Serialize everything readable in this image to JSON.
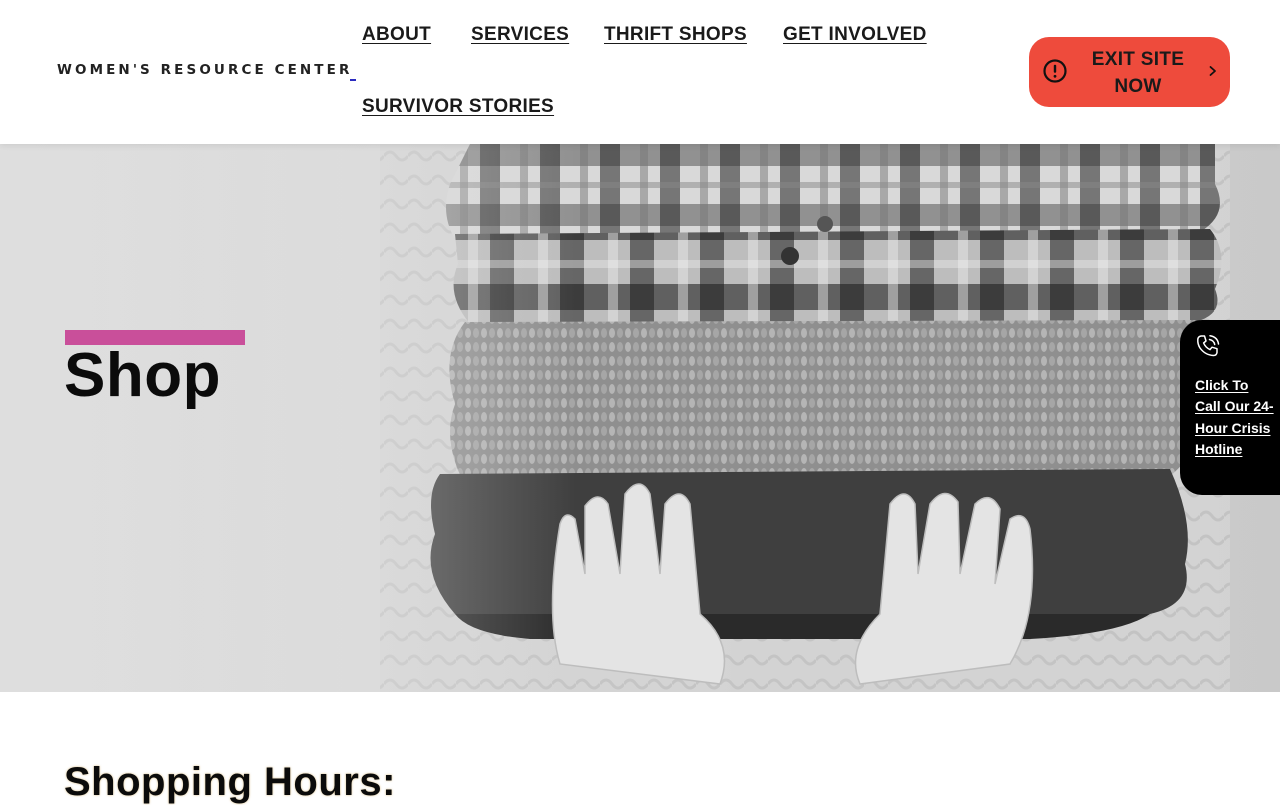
{
  "header": {
    "logo_text": "WOMEN'S RESOURCE CENTER",
    "nav": [
      {
        "label": "ABOUT"
      },
      {
        "label": "SERVICES"
      },
      {
        "label": "THRIFT SHOPS"
      },
      {
        "label": "GET INVOLVED"
      },
      {
        "label": "SURVIVOR STORIES"
      }
    ],
    "exit_button": {
      "label": "EXIT SITE NOW",
      "icon": "alert-circle-icon",
      "chevron_icon": "chevron-right-icon",
      "color": "#ee4b3c"
    }
  },
  "hero": {
    "title": "Shop",
    "accent_color": "#c94f9a",
    "image_subject": "folded-clothes-photo"
  },
  "crisis_tab": {
    "label": "Click To Call Our 24-Hour Crisis Hotline",
    "icon": "phone-call-icon",
    "background": "#000000"
  },
  "content": {
    "section_heading": "Shopping Hours:"
  }
}
